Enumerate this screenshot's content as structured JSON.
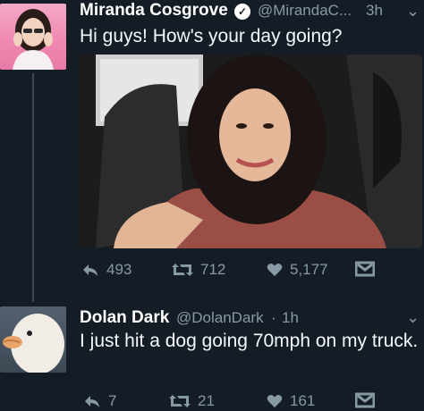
{
  "tweet1": {
    "display_name": "Miranda Cosgrove",
    "handle": "@MirandaC...",
    "time": "3h",
    "text": "Hi guys! How's your day going?",
    "actions": {
      "replies": "493",
      "retweets": "712",
      "likes": "5,177"
    }
  },
  "tweet2": {
    "display_name": "Dolan Dark",
    "handle": "@DolanDark",
    "time_sep": "·",
    "time": "1h",
    "text": "I just hit a dog going 70mph on my truck.",
    "actions": {
      "replies": "7",
      "retweets": "21",
      "likes": "161"
    }
  },
  "icons": {
    "reply": "reply-icon",
    "retweet": "retweet-icon",
    "like": "heart-icon",
    "dm": "envelope-icon",
    "more": "chevron-down-icon",
    "verified": "verified-badge-icon"
  },
  "colors": {
    "background": "#141d26",
    "name": "#ffffff",
    "meta": "#8899a6",
    "text": "#f5f8fa"
  }
}
